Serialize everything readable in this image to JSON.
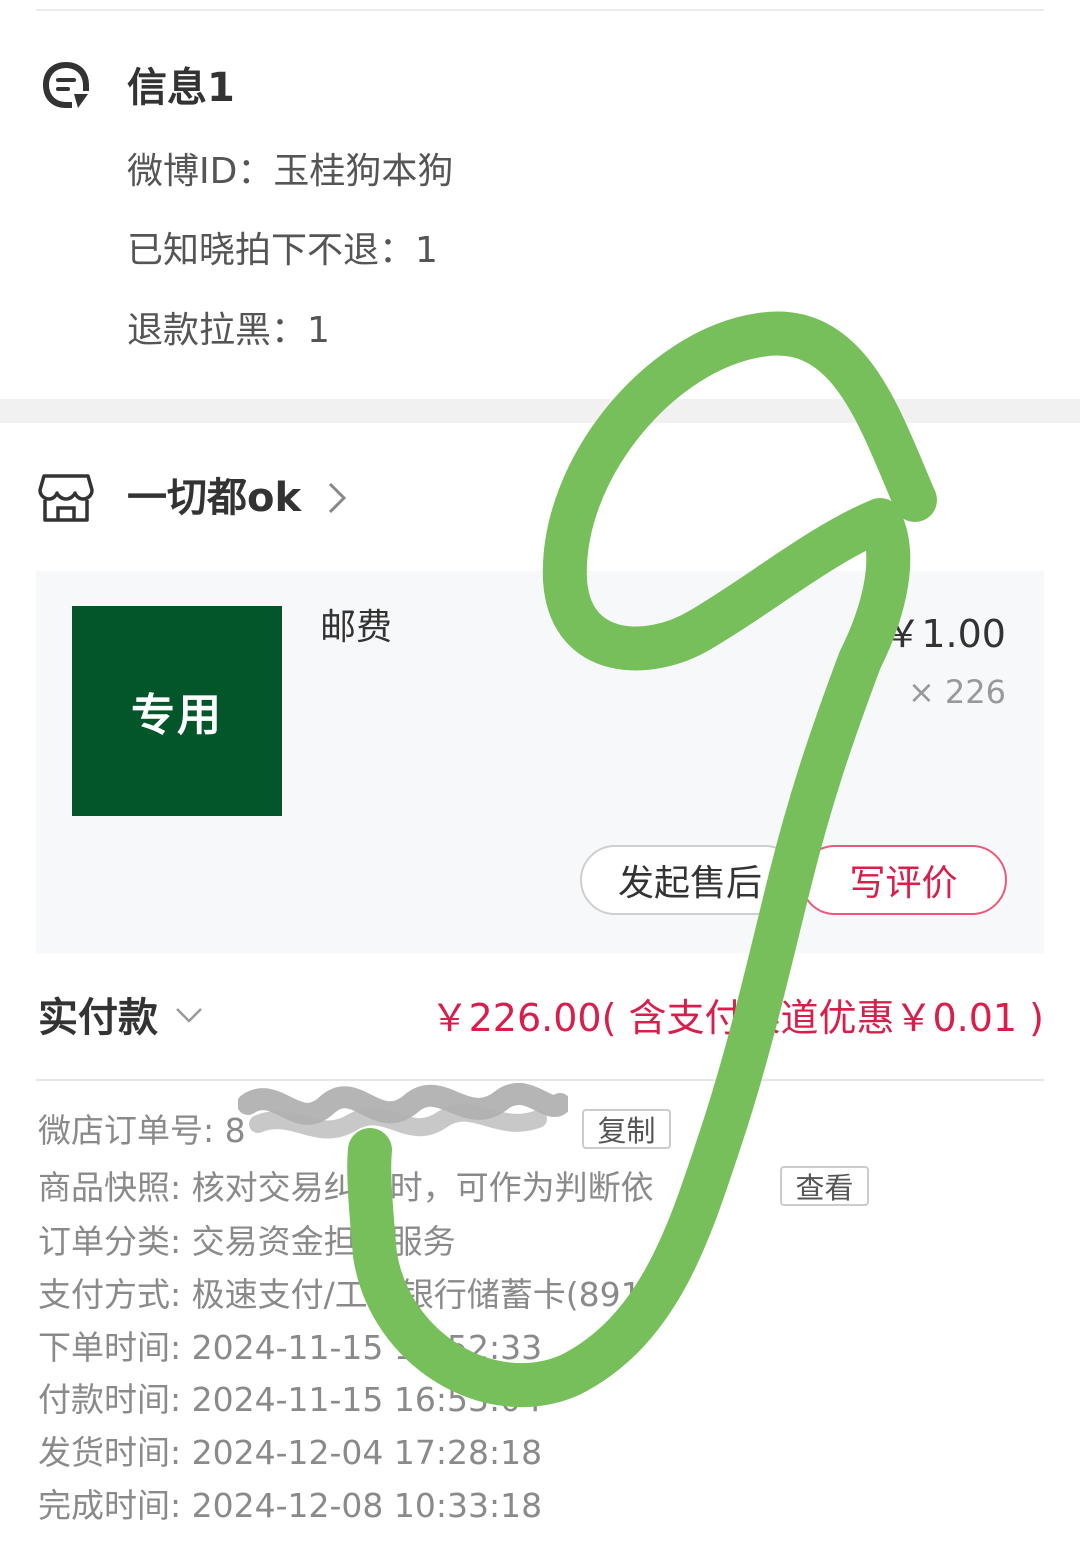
{
  "message": {
    "title": "信息1",
    "lines": [
      "微博ID：玉桂狗本狗",
      "已知晓拍下不退：1",
      "退款拉黑：1"
    ]
  },
  "shop": {
    "name": "一切都ok"
  },
  "item": {
    "thumb_text": "专用",
    "name": "邮费",
    "price": "￥1.00",
    "qty": "× 226",
    "after_sale_label": "发起售后",
    "review_label": "写评价"
  },
  "payment": {
    "label": "实付款",
    "amount": "￥226.00( 含支付渠道优惠￥0.01 )"
  },
  "order": {
    "number_label": "微店订单号: 8",
    "copy_label": "复制",
    "snapshot_text": "商品快照: 核对交易纠纷时，可作为判断依",
    "view_label": "查看",
    "category": "订单分类:  交易资金担保服务",
    "pay_method": "支付方式:  极速支付/工商银行储蓄卡(8917)",
    "order_time": "下单时间:  2024-11-15 16:52:33",
    "pay_time": "付款时间:  2024-11-15 16:53:04",
    "ship_time": "发货时间:  2024-12-04 17:28:18",
    "complete_time": "完成时间:  2024-12-08 10:33:18"
  },
  "colors": {
    "accent": "#d81e4a",
    "thumb_bg": "#03552a",
    "stroke": "#77bf5a"
  }
}
